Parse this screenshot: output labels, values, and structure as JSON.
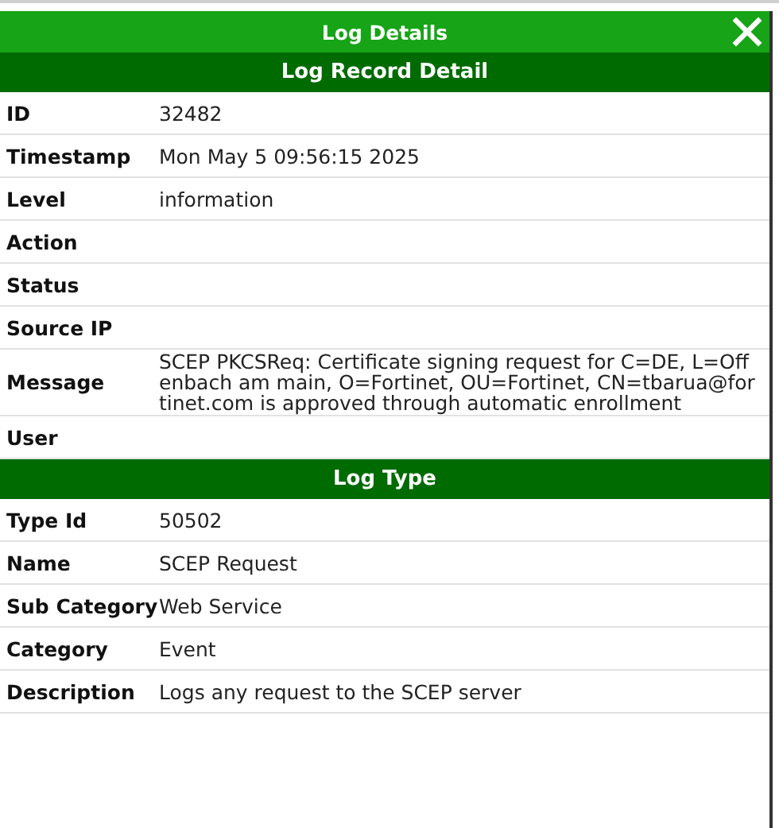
{
  "window": {
    "title": "Log Details"
  },
  "sections": [
    {
      "title": "Log Record Detail",
      "rows": [
        {
          "label": "ID",
          "value": "32482"
        },
        {
          "label": "Timestamp",
          "value": "Mon May 5 09:56:15 2025"
        },
        {
          "label": "Level",
          "value": "information"
        },
        {
          "label": "Action"
        },
        {
          "label": "Status"
        },
        {
          "label": "Source IP"
        },
        {
          "label": "Message",
          "value": "SCEP PKCSReq: Certificate signing request for C=DE, L=Offenbach am main, O=Fortinet, OU=Fortinet, CN=tbarua@fortinet.com is approved through automatic enrollment"
        },
        {
          "label": "User"
        }
      ]
    },
    {
      "title": "Log Type",
      "rows": [
        {
          "label": "Type Id",
          "value": "50502"
        },
        {
          "label": "Name",
          "value": "SCEP Request"
        },
        {
          "label": "Sub Category",
          "value": "Web Service"
        },
        {
          "label": "Category",
          "value": "Event"
        },
        {
          "label": "Description",
          "value": "Logs any request to the SCEP server"
        }
      ]
    }
  ]
}
